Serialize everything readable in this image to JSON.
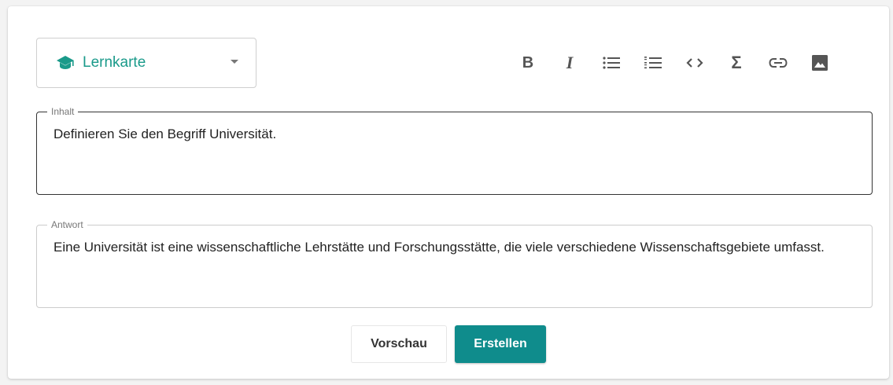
{
  "card_type": {
    "label": "Lernkarte",
    "icon": "graduation-cap-icon",
    "accent_color": "#1a9a8a"
  },
  "toolbar": {
    "items": [
      {
        "name": "bold",
        "icon": "bold-icon",
        "glyph": "B"
      },
      {
        "name": "italic",
        "icon": "italic-icon",
        "glyph": "I"
      },
      {
        "name": "bulleted-list",
        "icon": "bulleted-list-icon"
      },
      {
        "name": "numbered-list",
        "icon": "numbered-list-icon"
      },
      {
        "name": "code",
        "icon": "code-icon",
        "glyph": "<>"
      },
      {
        "name": "formula",
        "icon": "sigma-icon",
        "glyph": "Σ"
      },
      {
        "name": "link",
        "icon": "link-icon"
      },
      {
        "name": "image",
        "icon": "image-icon"
      }
    ]
  },
  "fields": {
    "inhalt": {
      "legend": "Inhalt",
      "value": "Definieren Sie den Begriff Universität."
    },
    "antwort": {
      "legend": "Antwort",
      "value": "Eine Universität ist eine wissenschaftliche Lehrstätte und Forschungsstätte, die viele verschiedene Wissenschaftsgebiete umfasst."
    }
  },
  "actions": {
    "preview_label": "Vorschau",
    "create_label": "Erstellen",
    "create_color": "#0f8c8c"
  }
}
